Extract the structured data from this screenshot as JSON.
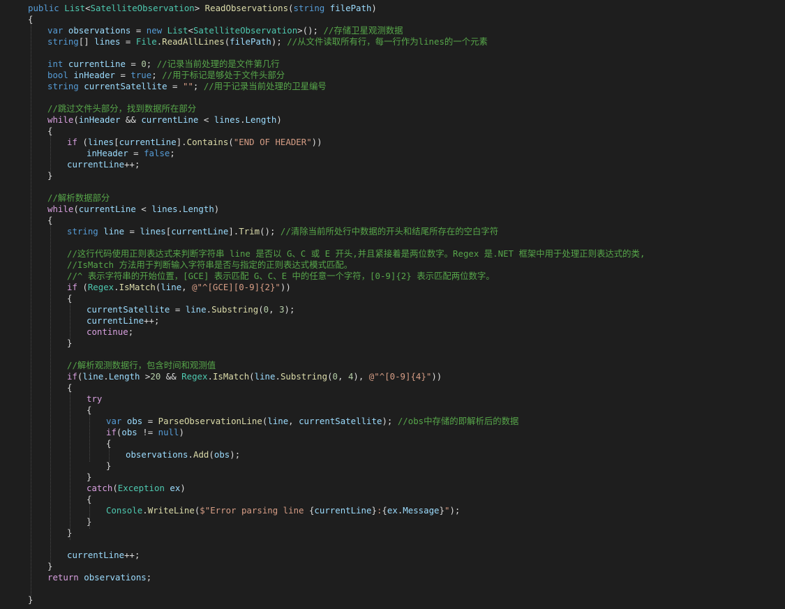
{
  "editor": {
    "language": "C#",
    "theme_colors": {
      "background": "#1e1e1e",
      "keyword": "#569cd6",
      "control": "#d8a0df",
      "type": "#4ec9b0",
      "method": "#dcdcaa",
      "string": "#d69d85",
      "number": "#b5cea8",
      "comment": "#57a64a",
      "identifier": "#9cdcfe",
      "plain": "#dcdcdc"
    },
    "lines": [
      {
        "indent": 0,
        "tokens": [
          {
            "t": "public",
            "c": "kw"
          },
          {
            "t": " "
          },
          {
            "t": "List",
            "c": "ty"
          },
          {
            "t": "<"
          },
          {
            "t": "SatelliteObservation",
            "c": "ty"
          },
          {
            "t": "> "
          },
          {
            "t": "ReadObservations",
            "c": "fn"
          },
          {
            "t": "("
          },
          {
            "t": "string",
            "c": "kw"
          },
          {
            "t": " "
          },
          {
            "t": "filePath",
            "c": "id"
          },
          {
            "t": ")"
          }
        ]
      },
      {
        "indent": 0,
        "tokens": [
          {
            "t": "{"
          }
        ]
      },
      {
        "indent": 1,
        "tokens": [
          {
            "t": "var",
            "c": "kw"
          },
          {
            "t": " "
          },
          {
            "t": "observations",
            "c": "id"
          },
          {
            "t": " = "
          },
          {
            "t": "new",
            "c": "kw"
          },
          {
            "t": " "
          },
          {
            "t": "List",
            "c": "ty"
          },
          {
            "t": "<"
          },
          {
            "t": "SatelliteObservation",
            "c": "ty"
          },
          {
            "t": ">(); "
          },
          {
            "t": "//存储卫星观测数据",
            "c": "cm"
          }
        ]
      },
      {
        "indent": 1,
        "tokens": [
          {
            "t": "string",
            "c": "kw"
          },
          {
            "t": "[] "
          },
          {
            "t": "lines",
            "c": "id"
          },
          {
            "t": " = "
          },
          {
            "t": "File",
            "c": "ty"
          },
          {
            "t": "."
          },
          {
            "t": "ReadAllLines",
            "c": "fn"
          },
          {
            "t": "("
          },
          {
            "t": "filePath",
            "c": "id"
          },
          {
            "t": "); "
          },
          {
            "t": "//从文件读取所有行，每一行作为lines的一个元素",
            "c": "cm"
          }
        ]
      },
      {
        "indent": 0,
        "tokens": []
      },
      {
        "indent": 1,
        "tokens": [
          {
            "t": "int",
            "c": "kw"
          },
          {
            "t": " "
          },
          {
            "t": "currentLine",
            "c": "id"
          },
          {
            "t": " = "
          },
          {
            "t": "0",
            "c": "num"
          },
          {
            "t": "; "
          },
          {
            "t": "//记录当前处理的是文件第几行",
            "c": "cm"
          }
        ]
      },
      {
        "indent": 1,
        "tokens": [
          {
            "t": "bool",
            "c": "kw"
          },
          {
            "t": " "
          },
          {
            "t": "inHeader",
            "c": "id"
          },
          {
            "t": " = "
          },
          {
            "t": "true",
            "c": "kw"
          },
          {
            "t": "; "
          },
          {
            "t": "//用于标记是够处于文件头部分",
            "c": "cm"
          }
        ]
      },
      {
        "indent": 1,
        "tokens": [
          {
            "t": "string",
            "c": "kw"
          },
          {
            "t": " "
          },
          {
            "t": "currentSatellite",
            "c": "id"
          },
          {
            "t": " = "
          },
          {
            "t": "\"\"",
            "c": "str"
          },
          {
            "t": "; "
          },
          {
            "t": "//用于记录当前处理的卫星编号",
            "c": "cm"
          }
        ]
      },
      {
        "indent": 0,
        "tokens": []
      },
      {
        "indent": 1,
        "tokens": [
          {
            "t": "//跳过文件头部分，找到数据所在部分",
            "c": "cm"
          }
        ]
      },
      {
        "indent": 1,
        "tokens": [
          {
            "t": "while",
            "c": "ctl"
          },
          {
            "t": "("
          },
          {
            "t": "inHeader",
            "c": "id"
          },
          {
            "t": " && "
          },
          {
            "t": "currentLine",
            "c": "id"
          },
          {
            "t": " < "
          },
          {
            "t": "lines",
            "c": "id"
          },
          {
            "t": "."
          },
          {
            "t": "Length",
            "c": "id"
          },
          {
            "t": ")"
          }
        ]
      },
      {
        "indent": 1,
        "tokens": [
          {
            "t": "{"
          }
        ]
      },
      {
        "indent": 2,
        "tokens": [
          {
            "t": "if",
            "c": "ctl"
          },
          {
            "t": " ("
          },
          {
            "t": "lines",
            "c": "id"
          },
          {
            "t": "["
          },
          {
            "t": "currentLine",
            "c": "id"
          },
          {
            "t": "]."
          },
          {
            "t": "Contains",
            "c": "fn"
          },
          {
            "t": "("
          },
          {
            "t": "\"END OF HEADER\"",
            "c": "str"
          },
          {
            "t": "))"
          }
        ]
      },
      {
        "indent": 3,
        "tokens": [
          {
            "t": "inHeader",
            "c": "id"
          },
          {
            "t": " = "
          },
          {
            "t": "false",
            "c": "kw"
          },
          {
            "t": ";"
          }
        ]
      },
      {
        "indent": 2,
        "tokens": [
          {
            "t": "currentLine",
            "c": "id"
          },
          {
            "t": "++;"
          }
        ]
      },
      {
        "indent": 1,
        "tokens": [
          {
            "t": "}"
          }
        ]
      },
      {
        "indent": 0,
        "tokens": []
      },
      {
        "indent": 1,
        "tokens": [
          {
            "t": "//解析数据部分",
            "c": "cm"
          }
        ]
      },
      {
        "indent": 1,
        "tokens": [
          {
            "t": "while",
            "c": "ctl"
          },
          {
            "t": "("
          },
          {
            "t": "currentLine",
            "c": "id"
          },
          {
            "t": " < "
          },
          {
            "t": "lines",
            "c": "id"
          },
          {
            "t": "."
          },
          {
            "t": "Length",
            "c": "id"
          },
          {
            "t": ")"
          }
        ]
      },
      {
        "indent": 1,
        "tokens": [
          {
            "t": "{"
          }
        ]
      },
      {
        "indent": 2,
        "tokens": [
          {
            "t": "string",
            "c": "kw"
          },
          {
            "t": " "
          },
          {
            "t": "line",
            "c": "id"
          },
          {
            "t": " = "
          },
          {
            "t": "lines",
            "c": "id"
          },
          {
            "t": "["
          },
          {
            "t": "currentLine",
            "c": "id"
          },
          {
            "t": "]."
          },
          {
            "t": "Trim",
            "c": "fn"
          },
          {
            "t": "(); "
          },
          {
            "t": "//清除当前所处行中数据的开头和结尾所存在的空白字符",
            "c": "cm"
          }
        ]
      },
      {
        "indent": 0,
        "tokens": []
      },
      {
        "indent": 2,
        "tokens": [
          {
            "t": "//这行代码使用正则表达式来判断字符串 line 是否以 G、C 或 E 开头,并且紧接着是两位数字。Regex 是.NET 框架中用于处理正则表达式的类,",
            "c": "cm"
          }
        ]
      },
      {
        "indent": 2,
        "tokens": [
          {
            "t": "//IsMatch 方法用于判断输入字符串是否与指定的正则表达式模式匹配。",
            "c": "cm"
          }
        ]
      },
      {
        "indent": 2,
        "tokens": [
          {
            "t": "//^ 表示字符串的开始位置，[GCE] 表示匹配 G、C、E 中的任意一个字符，[0-9]{2} 表示匹配两位数字。",
            "c": "cm"
          }
        ]
      },
      {
        "indent": 2,
        "tokens": [
          {
            "t": "if",
            "c": "ctl"
          },
          {
            "t": " ("
          },
          {
            "t": "Regex",
            "c": "ty"
          },
          {
            "t": "."
          },
          {
            "t": "IsMatch",
            "c": "fn"
          },
          {
            "t": "("
          },
          {
            "t": "line",
            "c": "id"
          },
          {
            "t": ", "
          },
          {
            "t": "@\"^[GCE][0-9]{2}\"",
            "c": "str"
          },
          {
            "t": "))"
          }
        ]
      },
      {
        "indent": 2,
        "tokens": [
          {
            "t": "{"
          }
        ]
      },
      {
        "indent": 3,
        "tokens": [
          {
            "t": "currentSatellite",
            "c": "id"
          },
          {
            "t": " = "
          },
          {
            "t": "line",
            "c": "id"
          },
          {
            "t": "."
          },
          {
            "t": "Substring",
            "c": "fn"
          },
          {
            "t": "("
          },
          {
            "t": "0",
            "c": "num"
          },
          {
            "t": ", "
          },
          {
            "t": "3",
            "c": "num"
          },
          {
            "t": ");"
          }
        ]
      },
      {
        "indent": 3,
        "tokens": [
          {
            "t": "currentLine",
            "c": "id"
          },
          {
            "t": "++;"
          }
        ]
      },
      {
        "indent": 3,
        "tokens": [
          {
            "t": "continue",
            "c": "ctl"
          },
          {
            "t": ";"
          }
        ]
      },
      {
        "indent": 2,
        "tokens": [
          {
            "t": "}"
          }
        ]
      },
      {
        "indent": 0,
        "tokens": []
      },
      {
        "indent": 2,
        "tokens": [
          {
            "t": "//解析观测数据行，包含时间和观测值",
            "c": "cm"
          }
        ]
      },
      {
        "indent": 2,
        "tokens": [
          {
            "t": "if",
            "c": "ctl"
          },
          {
            "t": "("
          },
          {
            "t": "line",
            "c": "id"
          },
          {
            "t": "."
          },
          {
            "t": "Length",
            "c": "id"
          },
          {
            "t": " >"
          },
          {
            "t": "20",
            "c": "num"
          },
          {
            "t": " && "
          },
          {
            "t": "Regex",
            "c": "ty"
          },
          {
            "t": "."
          },
          {
            "t": "IsMatch",
            "c": "fn"
          },
          {
            "t": "("
          },
          {
            "t": "line",
            "c": "id"
          },
          {
            "t": "."
          },
          {
            "t": "Substring",
            "c": "fn"
          },
          {
            "t": "("
          },
          {
            "t": "0",
            "c": "num"
          },
          {
            "t": ", "
          },
          {
            "t": "4",
            "c": "num"
          },
          {
            "t": "), "
          },
          {
            "t": "@\"^[0-9]{4}\"",
            "c": "str"
          },
          {
            "t": "))"
          }
        ]
      },
      {
        "indent": 2,
        "tokens": [
          {
            "t": "{"
          }
        ]
      },
      {
        "indent": 3,
        "tokens": [
          {
            "t": "try",
            "c": "ctl"
          }
        ]
      },
      {
        "indent": 3,
        "tokens": [
          {
            "t": "{"
          }
        ]
      },
      {
        "indent": 4,
        "tokens": [
          {
            "t": "var",
            "c": "kw"
          },
          {
            "t": " "
          },
          {
            "t": "obs",
            "c": "id"
          },
          {
            "t": " = "
          },
          {
            "t": "ParseObservationLine",
            "c": "fn"
          },
          {
            "t": "("
          },
          {
            "t": "line",
            "c": "id"
          },
          {
            "t": ", "
          },
          {
            "t": "currentSatellite",
            "c": "id"
          },
          {
            "t": "); "
          },
          {
            "t": "//obs中存储的即解析后的数据",
            "c": "cm"
          }
        ]
      },
      {
        "indent": 4,
        "tokens": [
          {
            "t": "if",
            "c": "ctl"
          },
          {
            "t": "("
          },
          {
            "t": "obs",
            "c": "id"
          },
          {
            "t": " != "
          },
          {
            "t": "null",
            "c": "kw"
          },
          {
            "t": ")"
          }
        ]
      },
      {
        "indent": 4,
        "tokens": [
          {
            "t": "{"
          }
        ]
      },
      {
        "indent": 5,
        "tokens": [
          {
            "t": "observations",
            "c": "id"
          },
          {
            "t": "."
          },
          {
            "t": "Add",
            "c": "fn"
          },
          {
            "t": "("
          },
          {
            "t": "obs",
            "c": "id"
          },
          {
            "t": ");"
          }
        ]
      },
      {
        "indent": 4,
        "tokens": [
          {
            "t": "}"
          }
        ]
      },
      {
        "indent": 3,
        "tokens": [
          {
            "t": "}"
          }
        ]
      },
      {
        "indent": 3,
        "tokens": [
          {
            "t": "catch",
            "c": "ctl"
          },
          {
            "t": "("
          },
          {
            "t": "Exception",
            "c": "ty"
          },
          {
            "t": " "
          },
          {
            "t": "ex",
            "c": "id"
          },
          {
            "t": ")"
          }
        ]
      },
      {
        "indent": 3,
        "tokens": [
          {
            "t": "{"
          }
        ]
      },
      {
        "indent": 4,
        "tokens": [
          {
            "t": "Console",
            "c": "ty"
          },
          {
            "t": "."
          },
          {
            "t": "WriteLine",
            "c": "fn"
          },
          {
            "t": "("
          },
          {
            "t": "$\"Error parsing line ",
            "c": "str"
          },
          {
            "t": "{"
          },
          {
            "t": "currentLine",
            "c": "id"
          },
          {
            "t": "}"
          },
          {
            "t": ":",
            "c": "str"
          },
          {
            "t": "{"
          },
          {
            "t": "ex",
            "c": "id"
          },
          {
            "t": "."
          },
          {
            "t": "Message",
            "c": "id"
          },
          {
            "t": "}"
          },
          {
            "t": "\"",
            "c": "str"
          },
          {
            "t": ");"
          }
        ]
      },
      {
        "indent": 3,
        "tokens": [
          {
            "t": "}"
          }
        ]
      },
      {
        "indent": 2,
        "tokens": [
          {
            "t": "}"
          }
        ]
      },
      {
        "indent": 0,
        "tokens": []
      },
      {
        "indent": 2,
        "tokens": [
          {
            "t": "currentLine",
            "c": "id"
          },
          {
            "t": "++;"
          }
        ]
      },
      {
        "indent": 1,
        "tokens": [
          {
            "t": "}"
          }
        ]
      },
      {
        "indent": 1,
        "tokens": [
          {
            "t": "return",
            "c": "ctl"
          },
          {
            "t": " "
          },
          {
            "t": "observations",
            "c": "id"
          },
          {
            "t": ";"
          }
        ]
      },
      {
        "indent": 0,
        "tokens": []
      },
      {
        "indent": 0,
        "tokens": [
          {
            "t": "}"
          }
        ]
      }
    ],
    "guides": [
      {
        "level": 0,
        "from": 1,
        "to": 53
      },
      {
        "level": 1,
        "from": 11,
        "to": 15
      },
      {
        "level": 1,
        "from": 19,
        "to": 50
      },
      {
        "level": 2,
        "from": 26,
        "to": 30
      },
      {
        "level": 2,
        "from": 34,
        "to": 48
      },
      {
        "level": 3,
        "from": 36,
        "to": 41
      },
      {
        "level": 3,
        "from": 44,
        "to": 47
      },
      {
        "level": 4,
        "from": 39,
        "to": 41
      }
    ]
  }
}
